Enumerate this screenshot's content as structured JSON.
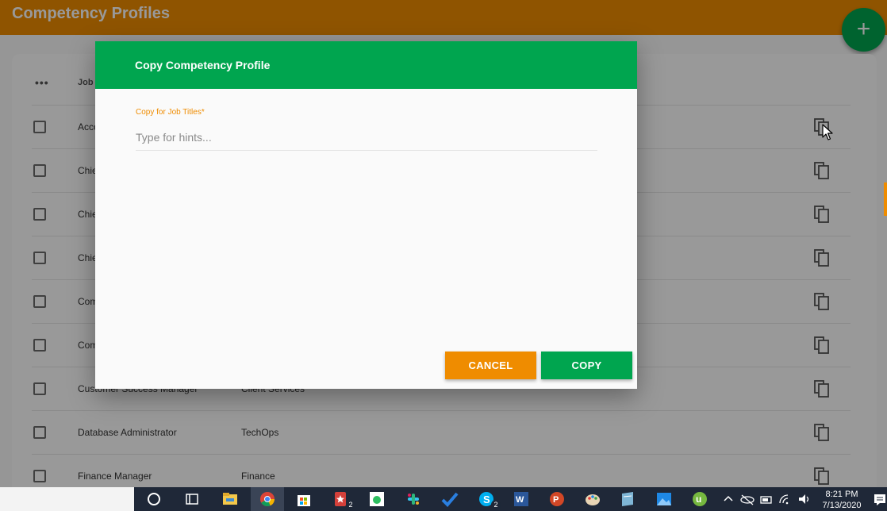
{
  "header": {
    "title": "Competency Profiles",
    "add_label": "+"
  },
  "table": {
    "menu_label": "•••",
    "column_job": "Job T",
    "rows": [
      {
        "name": "Acco",
        "dept": ""
      },
      {
        "name": "Chie",
        "dept": ""
      },
      {
        "name": "Chie",
        "dept": ""
      },
      {
        "name": "Chie",
        "dept": ""
      },
      {
        "name": "Com",
        "dept": ""
      },
      {
        "name": "Com",
        "dept": ""
      },
      {
        "name": "Customer Success Manager",
        "dept": "Client Services"
      },
      {
        "name": "Database Administrator",
        "dept": "TechOps"
      },
      {
        "name": "Finance Manager",
        "dept": "Finance"
      }
    ]
  },
  "dialog": {
    "title": "Copy Competency Profile",
    "field_label": "Copy for Job Titles",
    "required_mark": "*",
    "field_placeholder": "Type for hints...",
    "cancel_label": "CANCEL",
    "copy_label": "COPY"
  },
  "taskbar": {
    "time": "8:21 PM",
    "date": "7/13/2020",
    "badge_bookmark": "2",
    "badge_skype": "2"
  },
  "colors": {
    "brand_orange": "#ef8c00",
    "brand_green": "#00a54f"
  }
}
